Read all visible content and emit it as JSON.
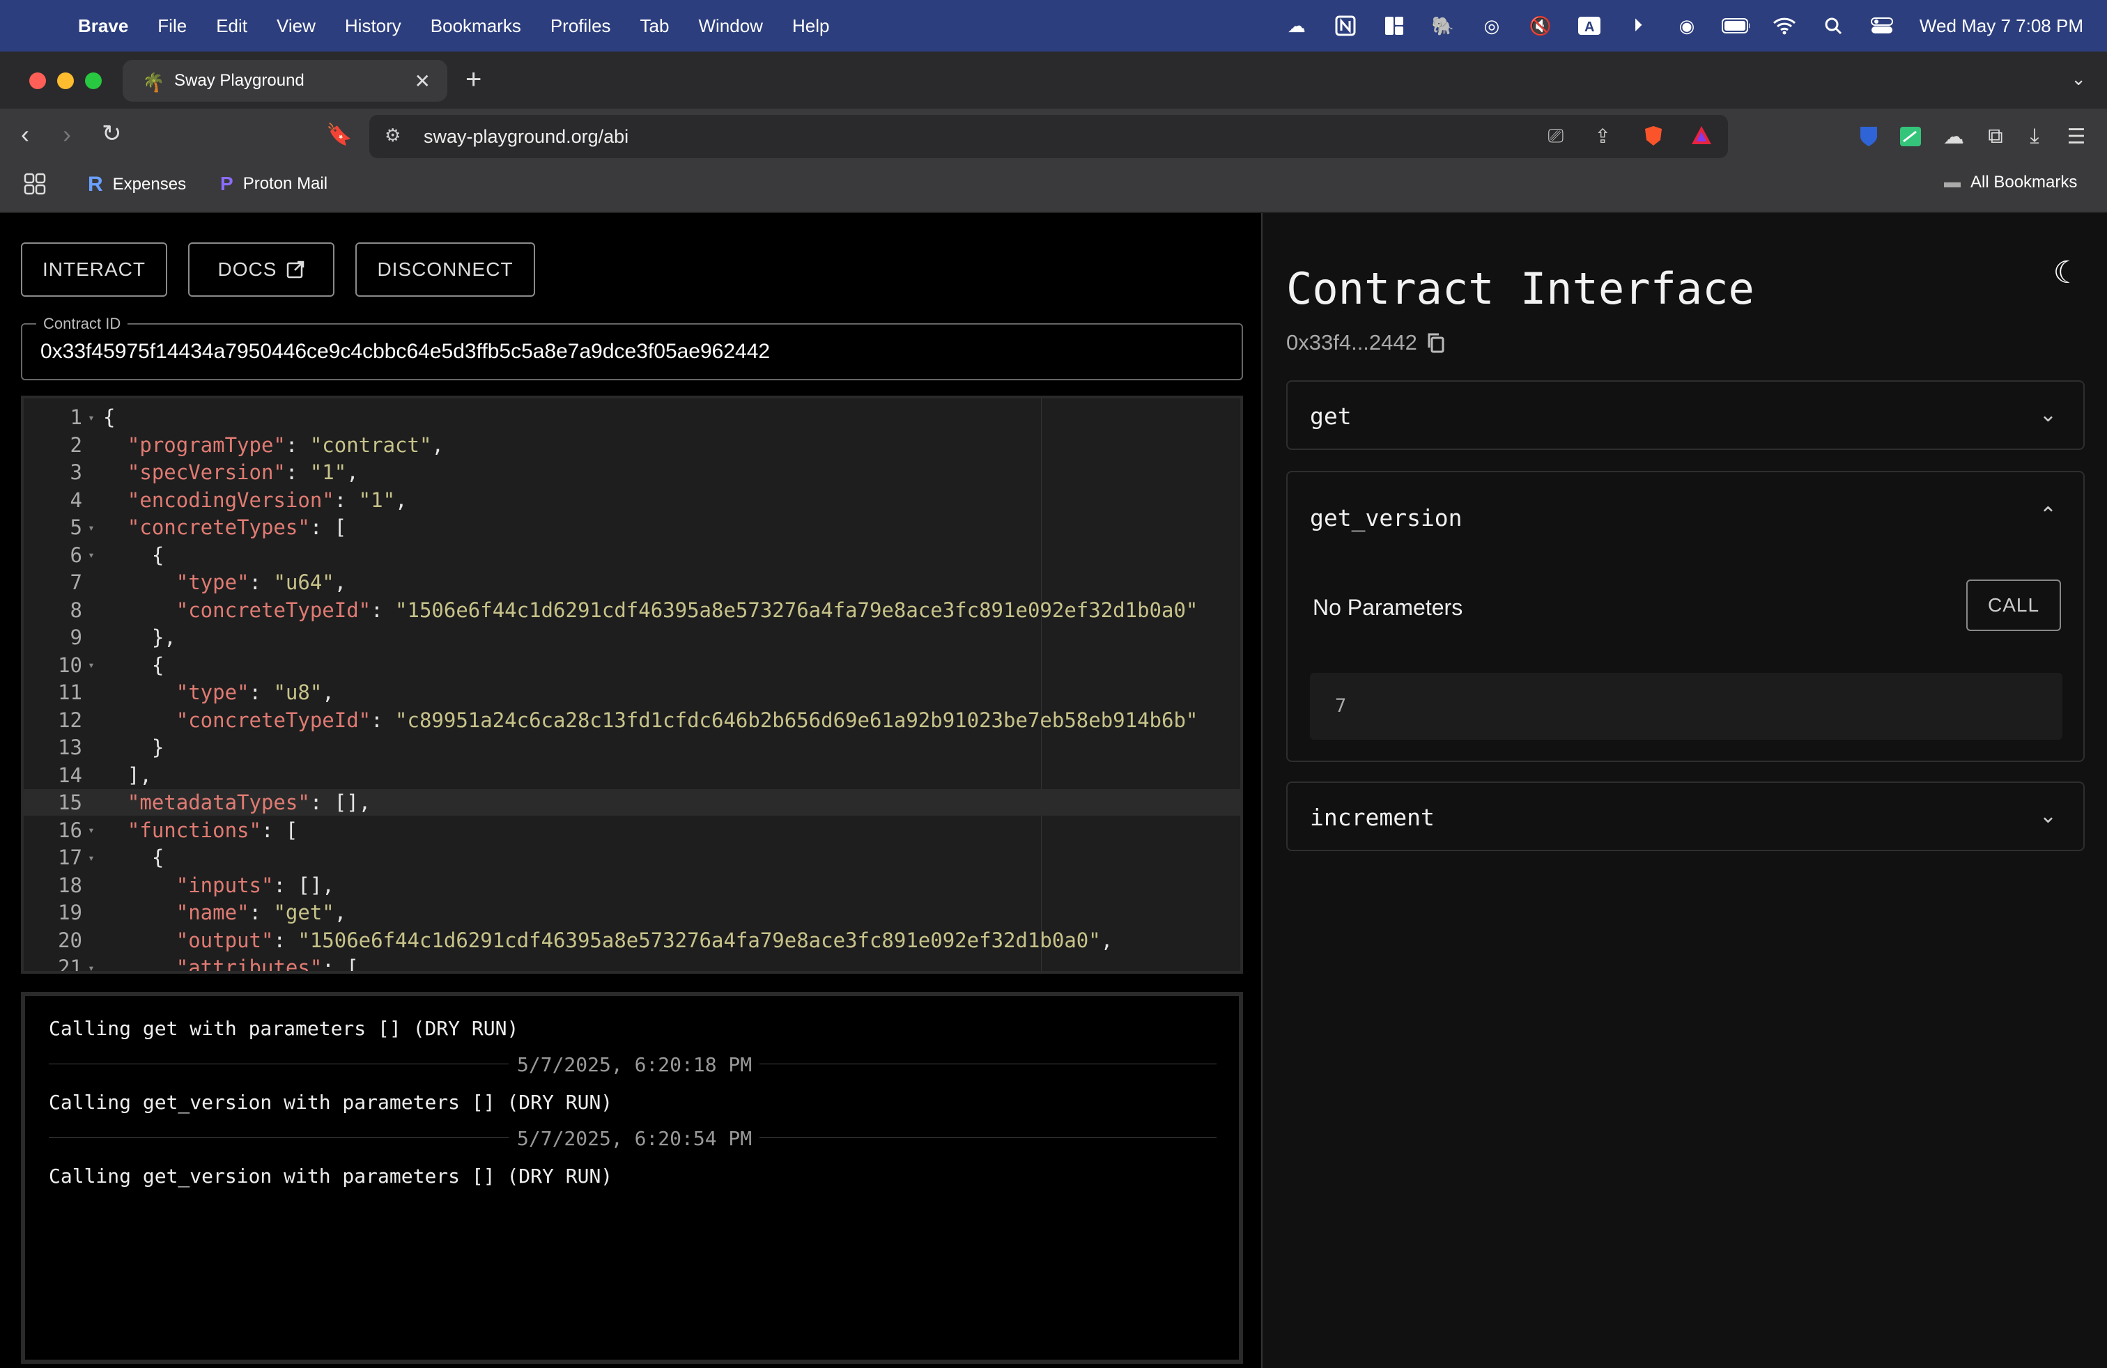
{
  "menubar": {
    "app": "Brave",
    "items": [
      "File",
      "Edit",
      "View",
      "History",
      "Bookmarks",
      "Profiles",
      "Tab",
      "Window",
      "Help"
    ],
    "clock": "Wed May 7  7:08 PM"
  },
  "browser": {
    "tab_title": "Sway Playground",
    "url": "sway-playground.org/abi",
    "bookmarks": [
      "Expenses",
      "Proton Mail"
    ],
    "all_bookmarks": "All Bookmarks"
  },
  "left": {
    "buttons": {
      "interact": "INTERACT",
      "docs": "DOCS",
      "disconnect": "DISCONNECT"
    },
    "contract_id_label": "Contract ID",
    "contract_id": "0x33f45975f14434a7950446ce9c4cbbc64e5d3ffb5c5a8e7a9dce3f05ae962442"
  },
  "editor": {
    "lines": [
      "{",
      "  \"programType\": \"contract\",",
      "  \"specVersion\": \"1\",",
      "  \"encodingVersion\": \"1\",",
      "  \"concreteTypes\": [",
      "    {",
      "      \"type\": \"u64\",",
      "      \"concreteTypeId\": \"1506e6f44c1d6291cdf46395a8e573276a4fa79e8ace3fc891e092ef32d1b0a0\"",
      "    },",
      "    {",
      "      \"type\": \"u8\",",
      "      \"concreteTypeId\": \"c89951a24c6ca28c13fd1cfdc646b2b656d69e61a92b91023be7eb58eb914b6b\"",
      "    }",
      "  ],",
      "  \"metadataTypes\": [],",
      "  \"functions\": [",
      "    {",
      "      \"inputs\": [],",
      "      \"name\": \"get\",",
      "      \"output\": \"1506e6f44c1d6291cdf46395a8e573276a4fa79e8ace3fc891e092ef32d1b0a0\",",
      "      \"attributes\": ["
    ],
    "fold_lines": [
      1,
      5,
      6,
      10,
      16,
      17,
      21
    ],
    "active_line": 15
  },
  "console": {
    "entries": [
      "Calling get with parameters [] (DRY RUN)",
      "Calling get_version with parameters [] (DRY RUN)",
      "Calling get_version with parameters [] (DRY RUN)"
    ],
    "timestamps": [
      "5/7/2025, 6:20:18 PM",
      "5/7/2025, 6:20:54 PM"
    ]
  },
  "right": {
    "title": "Contract Interface",
    "address_short": "0x33f4...2442",
    "functions": [
      {
        "name": "get",
        "expanded": false
      },
      {
        "name": "get_version",
        "expanded": true,
        "params_text": "No Parameters",
        "call_label": "CALL",
        "output": "7"
      },
      {
        "name": "increment",
        "expanded": false
      }
    ]
  }
}
